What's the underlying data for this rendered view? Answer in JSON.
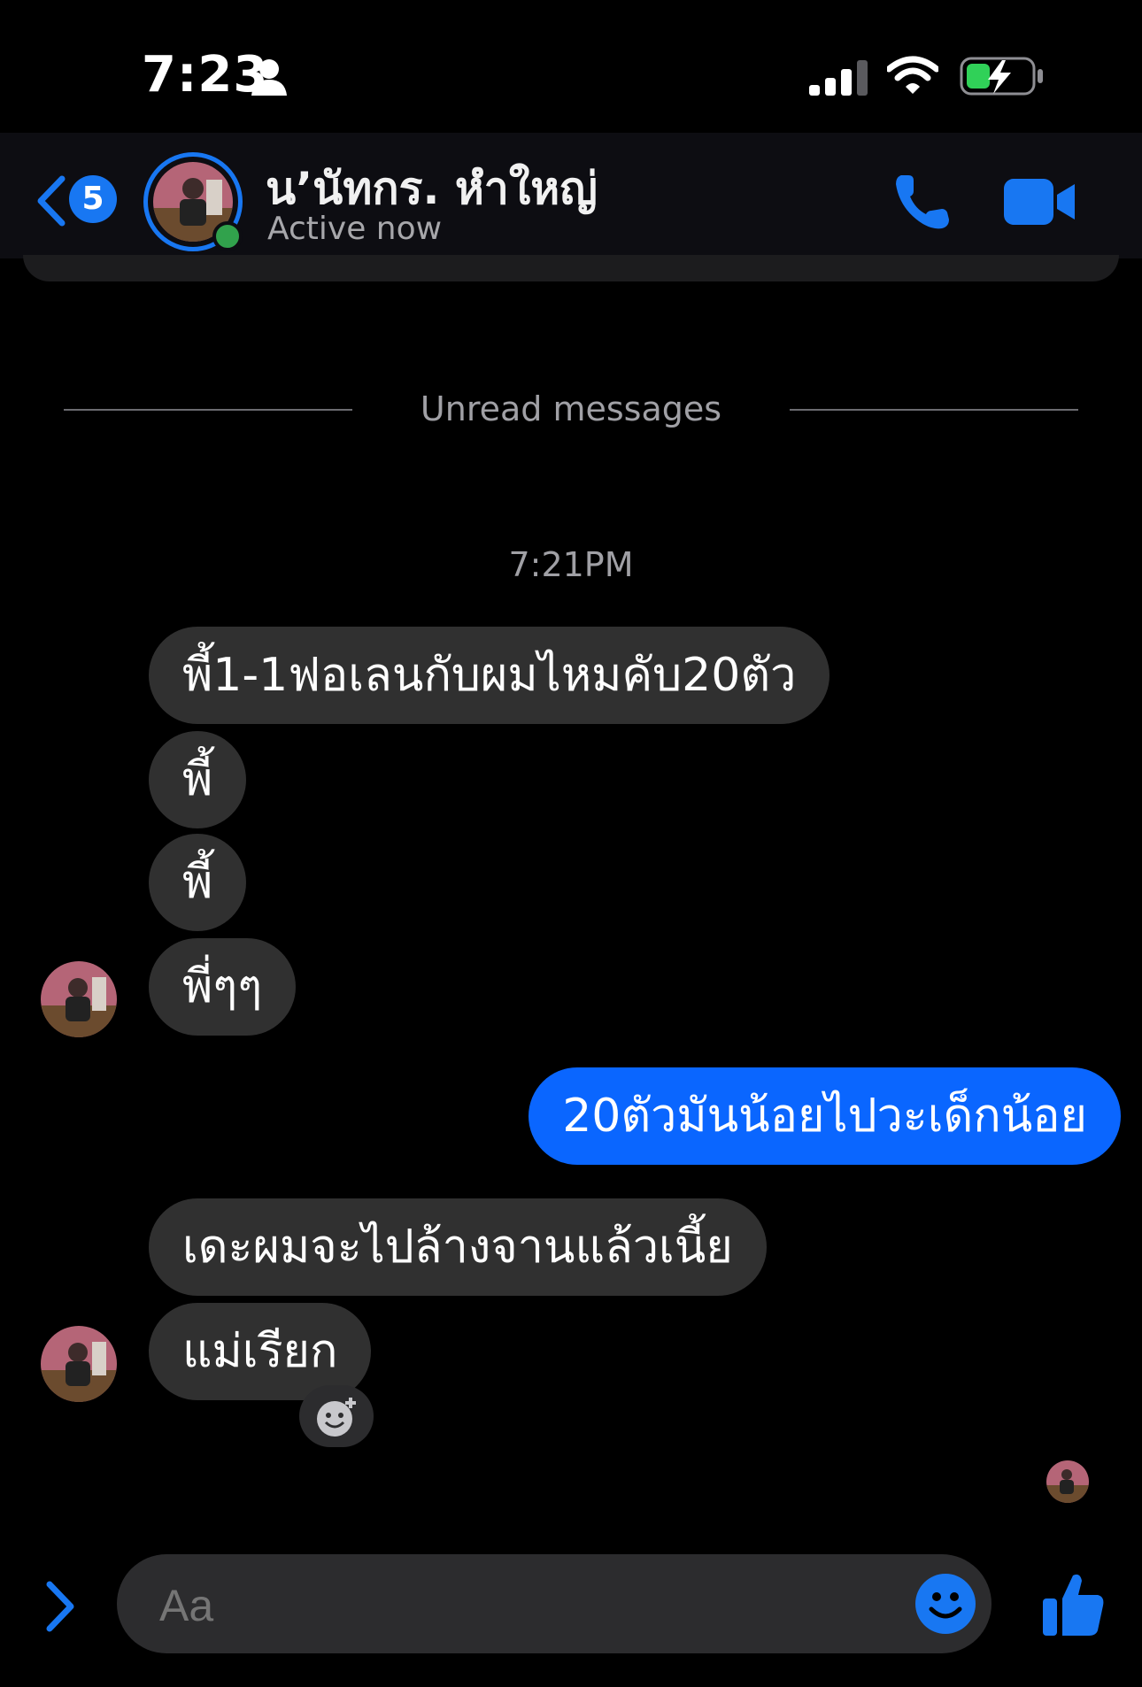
{
  "status_bar": {
    "time": "7:23",
    "person_icon": "person-icon",
    "signal_icon": "cellular-signal-icon",
    "wifi_icon": "wifi-icon",
    "battery_icon": "battery-charging-icon"
  },
  "header": {
    "back_icon": "chevron-left-icon",
    "unread_count": "5",
    "contact_name": "น’นัทกร. หำใหญ่",
    "status": "Active now",
    "call_icon": "phone-icon",
    "video_icon": "video-camera-icon"
  },
  "divider": {
    "label": "Unread messages"
  },
  "timestamp": "7:21PM",
  "messages": [
    {
      "from": "them",
      "text": "พี้1-1ฟอเลนกับผมไหมคับ20ตัว"
    },
    {
      "from": "them",
      "text": "พี้"
    },
    {
      "from": "them",
      "text": "พี้"
    },
    {
      "from": "them",
      "text": "พี่ๆๆ"
    },
    {
      "from": "me",
      "text": "20ตัวมันน้อยไปวะเด็กน้อย"
    },
    {
      "from": "them",
      "text": "เดะผมจะไปล้างจานแล้วเนี้ย"
    },
    {
      "from": "them",
      "text": "แม่เรียก"
    }
  ],
  "composer": {
    "placeholder": "Aa",
    "expand_icon": "chevron-right-icon",
    "emoji_icon": "smiley-icon",
    "like_icon": "thumbs-up-icon",
    "react_icon": "add-reaction-icon"
  },
  "colors": {
    "accent": "#1877f2",
    "outgoing": "#0a66ff",
    "incoming": "#303030",
    "online": "#31a24c"
  }
}
